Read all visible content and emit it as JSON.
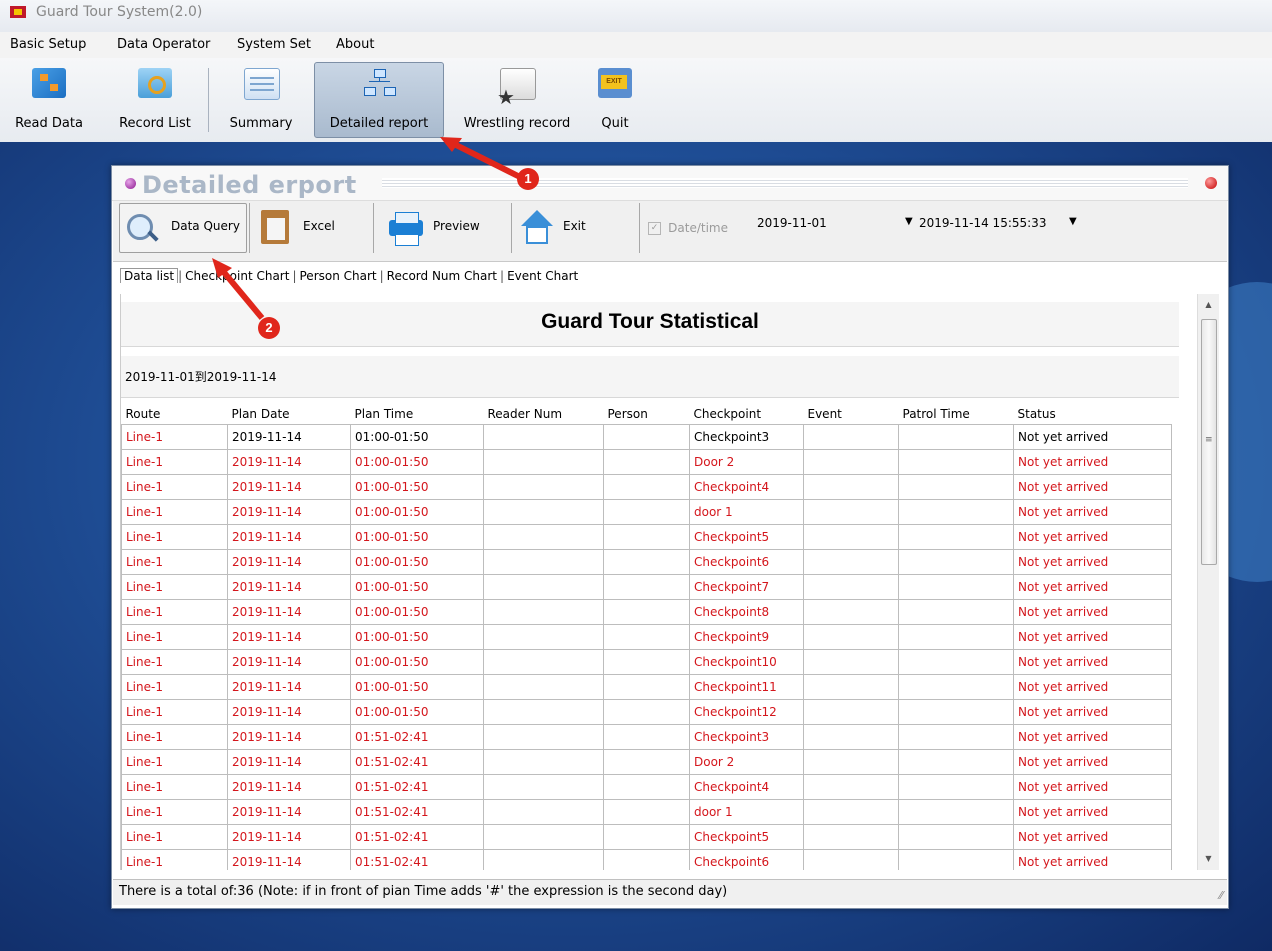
{
  "app": {
    "title": "Guard Tour System(2.0)"
  },
  "menu": [
    "Basic Setup",
    "Data Operator",
    "System Set",
    "About"
  ],
  "toolbar": [
    "Read Data",
    "Record List",
    "Summary",
    "Detailed report",
    "Wrestling record",
    "Quit"
  ],
  "quit_icon_text": "EXIT",
  "window": {
    "title": "Detailed erport"
  },
  "inner_toolbar": {
    "query": "Data Query",
    "excel": "Excel",
    "preview": "Preview",
    "exit": "Exit",
    "datetime_label": "Date/time",
    "date_from": "2019-11-01",
    "date_to": "2019-11-14 15:55:33"
  },
  "tabs": [
    "Data list",
    "Checkpoint Chart",
    "Person Chart",
    "Record Num Chart",
    "Event Chart"
  ],
  "report": {
    "title": "Guard Tour Statistical",
    "range": "2019-11-01到2019-11-14",
    "columns": [
      "Route",
      "Plan Date",
      "Plan Time",
      "Reader Num",
      "Person",
      "Checkpoint",
      "Event",
      "Patrol Time",
      "Status"
    ],
    "rows": [
      [
        "Line-1",
        "2019-11-14",
        "01:00-01:50",
        "",
        "",
        "Checkpoint3",
        "",
        "",
        "Not yet arrived"
      ],
      [
        "Line-1",
        "2019-11-14",
        "01:00-01:50",
        "",
        "",
        "Door 2",
        "",
        "",
        "Not yet arrived"
      ],
      [
        "Line-1",
        "2019-11-14",
        "01:00-01:50",
        "",
        "",
        "Checkpoint4",
        "",
        "",
        "Not yet arrived"
      ],
      [
        "Line-1",
        "2019-11-14",
        "01:00-01:50",
        "",
        "",
        "door 1",
        "",
        "",
        "Not yet arrived"
      ],
      [
        "Line-1",
        "2019-11-14",
        "01:00-01:50",
        "",
        "",
        "Checkpoint5",
        "",
        "",
        "Not yet arrived"
      ],
      [
        "Line-1",
        "2019-11-14",
        "01:00-01:50",
        "",
        "",
        "Checkpoint6",
        "",
        "",
        "Not yet arrived"
      ],
      [
        "Line-1",
        "2019-11-14",
        "01:00-01:50",
        "",
        "",
        "Checkpoint7",
        "",
        "",
        "Not yet arrived"
      ],
      [
        "Line-1",
        "2019-11-14",
        "01:00-01:50",
        "",
        "",
        "Checkpoint8",
        "",
        "",
        "Not yet arrived"
      ],
      [
        "Line-1",
        "2019-11-14",
        "01:00-01:50",
        "",
        "",
        "Checkpoint9",
        "",
        "",
        "Not yet arrived"
      ],
      [
        "Line-1",
        "2019-11-14",
        "01:00-01:50",
        "",
        "",
        "Checkpoint10",
        "",
        "",
        "Not yet arrived"
      ],
      [
        "Line-1",
        "2019-11-14",
        "01:00-01:50",
        "",
        "",
        "Checkpoint11",
        "",
        "",
        "Not yet arrived"
      ],
      [
        "Line-1",
        "2019-11-14",
        "01:00-01:50",
        "",
        "",
        "Checkpoint12",
        "",
        "",
        "Not yet arrived"
      ],
      [
        "Line-1",
        "2019-11-14",
        "01:51-02:41",
        "",
        "",
        "Checkpoint3",
        "",
        "",
        "Not yet arrived"
      ],
      [
        "Line-1",
        "2019-11-14",
        "01:51-02:41",
        "",
        "",
        "Door 2",
        "",
        "",
        "Not yet arrived"
      ],
      [
        "Line-1",
        "2019-11-14",
        "01:51-02:41",
        "",
        "",
        "Checkpoint4",
        "",
        "",
        "Not yet arrived"
      ],
      [
        "Line-1",
        "2019-11-14",
        "01:51-02:41",
        "",
        "",
        "door 1",
        "",
        "",
        "Not yet arrived"
      ],
      [
        "Line-1",
        "2019-11-14",
        "01:51-02:41",
        "",
        "",
        "Checkpoint5",
        "",
        "",
        "Not yet arrived"
      ],
      [
        "Line-1",
        "2019-11-14",
        "01:51-02:41",
        "",
        "",
        "Checkpoint6",
        "",
        "",
        "Not yet arrived"
      ]
    ]
  },
  "status_bar": "There is a total of:36 (Note: if in front of pian Time adds  '#'  the expression is the second day)",
  "annotations": [
    "1",
    "2"
  ],
  "colors": {
    "accent_red": "#d4161c",
    "annotation_red": "#e0261b"
  }
}
